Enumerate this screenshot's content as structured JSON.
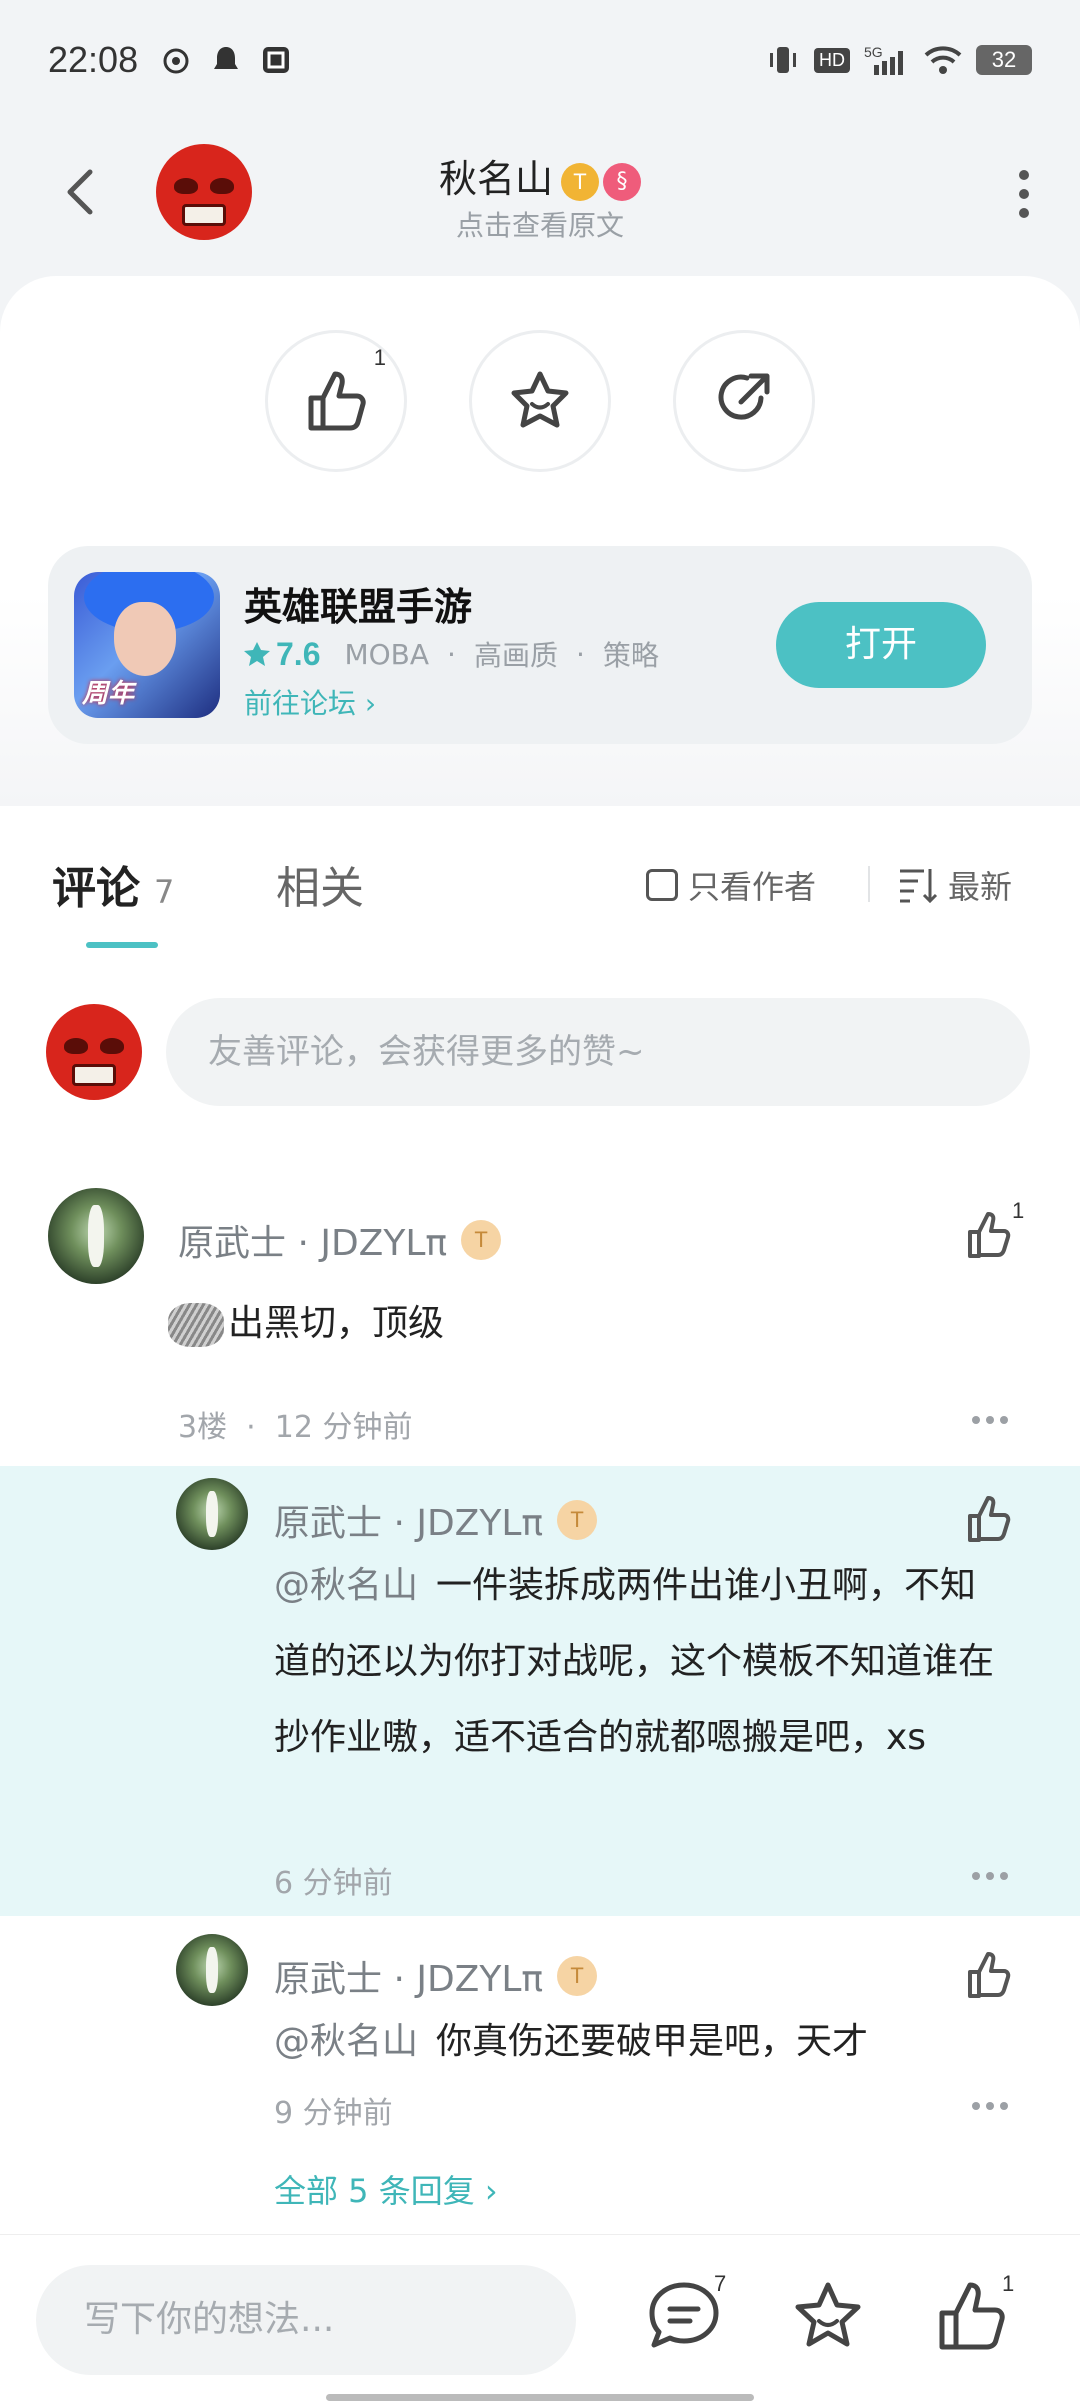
{
  "status_bar": {
    "time": "22:08",
    "network": "5G",
    "battery": "32"
  },
  "header": {
    "title": "秋名山",
    "level_badge": "T",
    "subtitle": "点击查看原文"
  },
  "actions": {
    "like_count": "1"
  },
  "game": {
    "name": "英雄联盟手游",
    "score": "7.6",
    "tags": [
      "MOBA",
      "高画质",
      "策略"
    ],
    "forum_link": "前往论坛",
    "open_label": "打开",
    "icon_text": "周年"
  },
  "comments_tab": {
    "label": "评论",
    "count": "7",
    "related_label": "相关",
    "author_only": "只看作者",
    "sort_label": "最新"
  },
  "composer": {
    "placeholder": "友善评论，会获得更多的赞~"
  },
  "comment": {
    "author": "原武士 · JDZYLπ",
    "level": "T",
    "text": "出黑切，顶级",
    "floor": "3楼",
    "time": "12 分钟前",
    "like_count": "1"
  },
  "replies": [
    {
      "author": "原武士 · JDZYLπ",
      "level": "T",
      "mention": "@秋名山",
      "text": "一件装拆成两件出谁小丑啊，不知道的还以为你打对战呢，这个模板不知道谁在抄作业嗷，适不适合的就都嗯搬是吧，xs",
      "time": "6 分钟前"
    },
    {
      "author": "原武士 · JDZYLπ",
      "level": "T",
      "mention": "@秋名山",
      "text": "你真伤还要破甲是吧，天才",
      "time": "9 分钟前"
    }
  ],
  "show_all_replies": "全部 5 条回复 ›",
  "bottom_bar": {
    "placeholder": "写下你的想法...",
    "comment_count": "7",
    "like_count": "1"
  }
}
